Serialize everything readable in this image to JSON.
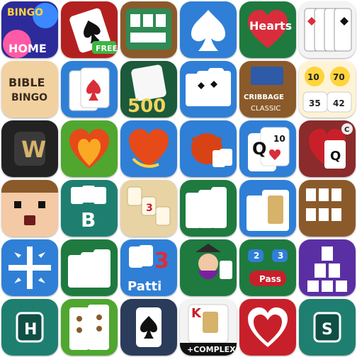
{
  "icons": [
    {
      "icon": "bingo-home-app-icon",
      "text": [
        "BINGO",
        "HOME"
      ]
    },
    {
      "icon": "spades-free-app-icon",
      "text": [
        "FREE"
      ]
    },
    {
      "icon": "solitaire-table-app-icon",
      "text": []
    },
    {
      "icon": "spade-app-icon",
      "text": []
    },
    {
      "icon": "hearts-app-icon",
      "text": [
        "Hearts"
      ]
    },
    {
      "icon": "card-fan-app-icon",
      "text": []
    },
    {
      "icon": "bible-bingo-app-icon",
      "text": [
        "BIBLE",
        "BINGO"
      ]
    },
    {
      "icon": "seven-cards-app-icon",
      "text": []
    },
    {
      "icon": "500-cards-app-icon",
      "text": [
        "500"
      ]
    },
    {
      "icon": "spades-cards-app-icon",
      "text": []
    },
    {
      "icon": "cribbage-classic-app-icon",
      "text": [
        "CRIBBAGE",
        "CLASSIC"
      ]
    },
    {
      "icon": "bingo-balls-app-icon",
      "text": [
        "10",
        "70",
        "35",
        "42"
      ]
    },
    {
      "icon": "words-w-app-icon",
      "text": [
        "W"
      ]
    },
    {
      "icon": "heart-flame-app-icon",
      "text": []
    },
    {
      "icon": "heart-spin-app-icon",
      "text": []
    },
    {
      "icon": "devil-cards-app-icon",
      "text": []
    },
    {
      "icon": "queen-hearts-app-icon",
      "text": [
        "Q",
        "10"
      ]
    },
    {
      "icon": "queen-spades-app-icon",
      "text": [
        "Q",
        "C"
      ]
    },
    {
      "icon": "blocky-face-app-icon",
      "text": []
    },
    {
      "icon": "belote-b-app-icon",
      "text": [
        "B"
      ]
    },
    {
      "icon": "rummy-tiles-app-icon",
      "text": [
        "3"
      ]
    },
    {
      "icon": "green-cards-app-icon",
      "text": []
    },
    {
      "icon": "jack-cards-app-icon",
      "text": []
    },
    {
      "icon": "wood-solitaire-app-icon",
      "text": []
    },
    {
      "icon": "blue-cross-app-icon",
      "text": []
    },
    {
      "icon": "green-table-cards-app-icon",
      "text": []
    },
    {
      "icon": "teen-patti-app-icon",
      "text": [
        "3",
        "Patti"
      ]
    },
    {
      "icon": "witch-solitaire-app-icon",
      "text": []
    },
    {
      "icon": "pass-game-app-icon",
      "text": [
        "2",
        "3",
        "Pass"
      ]
    },
    {
      "icon": "purple-pyramid-app-icon",
      "text": []
    },
    {
      "icon": "hearts-h-app-icon",
      "text": [
        "H"
      ]
    },
    {
      "icon": "dots-cards-app-icon",
      "text": []
    },
    {
      "icon": "dark-spade-card-app-icon",
      "text": []
    },
    {
      "icon": "king-complex-app-icon",
      "text": [
        "K",
        "+COMPLEX"
      ]
    },
    {
      "icon": "big-heart-app-icon",
      "text": []
    },
    {
      "icon": "spades-s-app-icon",
      "text": [
        "S"
      ]
    }
  ],
  "colors": {
    "green_felt": "#1f7a3f",
    "blue": "#2f7fd6",
    "red": "#c8202a",
    "wood": "#8b5a2b",
    "purple": "#5a2fa3",
    "teal": "#1e7f70"
  }
}
